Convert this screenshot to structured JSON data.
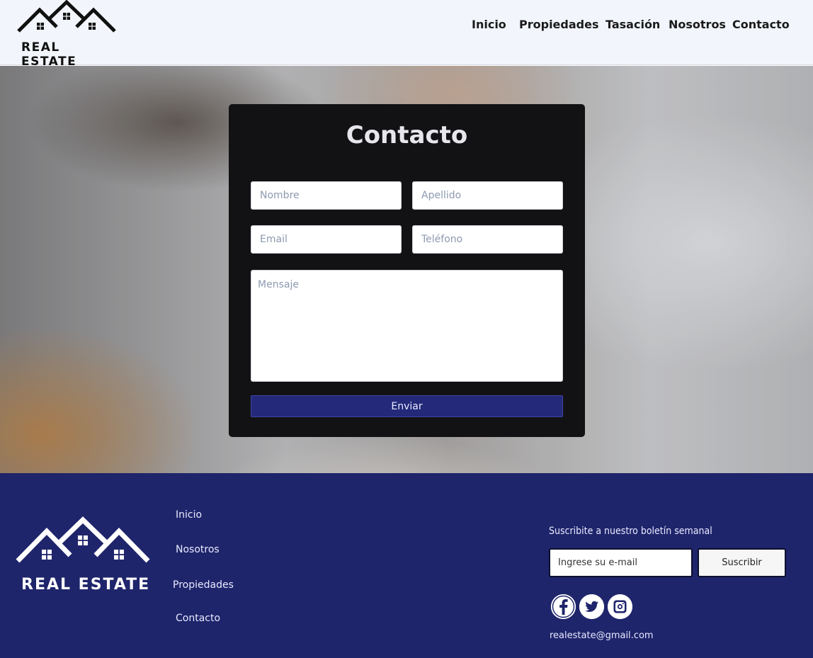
{
  "brand": {
    "name": "REAL ESTATE"
  },
  "nav": {
    "items": [
      {
        "label": "Inicio"
      },
      {
        "label": "Propiedades"
      },
      {
        "label": "Tasación"
      },
      {
        "label": "Nosotros"
      },
      {
        "label": "Contacto"
      }
    ]
  },
  "form": {
    "title": "Contacto",
    "nombre_placeholder": "Nombre",
    "apellido_placeholder": "Apellido",
    "email_placeholder": "Email",
    "telefono_placeholder": "Teléfono",
    "mensaje_placeholder": "Mensaje",
    "submit_label": "Enviar"
  },
  "footer": {
    "links": [
      {
        "label": "Inicio"
      },
      {
        "label": "Nosotros"
      },
      {
        "label": "Propiedades"
      },
      {
        "label": "Contacto"
      }
    ],
    "newsletter_title": "Suscribite a nuestro boletín semanal",
    "email_placeholder": "Ingrese su e-mail",
    "subscribe_label": "Suscribir",
    "social": [
      "facebook-icon",
      "twitter-icon",
      "instagram-icon"
    ],
    "contact_email": "realestate@gmail.com"
  },
  "colors": {
    "header_bg": "#f2f5fb",
    "card_bg": "#121214",
    "accent": "#24297a",
    "footer_bg": "#1f256b"
  }
}
